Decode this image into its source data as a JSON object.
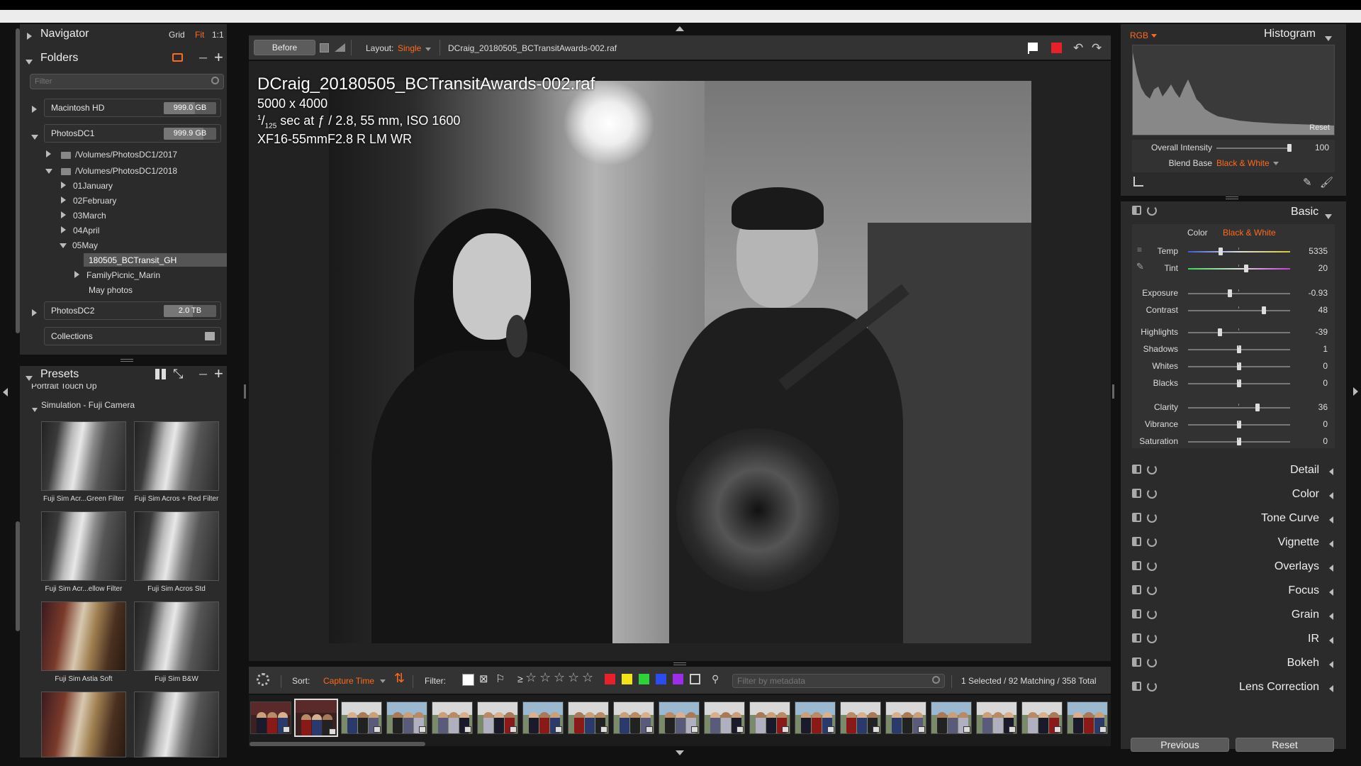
{
  "navigator": {
    "title": "Navigator",
    "grid": "Grid",
    "fit": "Fit",
    "one_to_one": "1:1"
  },
  "folders": {
    "title": "Folders",
    "filter_placeholder": "Filter",
    "volumes": [
      {
        "name": "Macintosh HD",
        "size": "999.0 GB",
        "fill": 0.6
      },
      {
        "name": "PhotosDC1",
        "size": "999.9 GB",
        "fill": 0.75
      },
      {
        "name": "PhotosDC2",
        "size": "2.0 TB",
        "fill": 0.55
      }
    ],
    "tree": {
      "path2017": "/Volumes/PhotosDC1/2017",
      "path2018": "/Volumes/PhotosDC1/2018",
      "months": [
        "01January",
        "02February",
        "03March",
        "04April",
        "05May"
      ],
      "selected": "180505_BCTransit_GH",
      "sub1": "FamilyPicnic_Marin",
      "sub2": "May photos"
    },
    "collections": "Collections"
  },
  "presets": {
    "title": "Presets",
    "prev_group": "Portrait Touch Up",
    "group": "Simulation - Fuji Camera",
    "items": [
      "Fuji Sim Acr...Green Filter",
      "Fuji Sim Acros + Red Filter",
      "Fuji Sim Acr...ellow Filter",
      "Fuji Sim Acros Std",
      "Fuji Sim Astia Soft",
      "Fuji Sim B&W"
    ]
  },
  "toolbar": {
    "before": "Before",
    "layout_label": "Layout:",
    "layout_value": "Single",
    "filename": "DCraig_20180505_BCTransitAwards-002.raf"
  },
  "overlay": {
    "filename": "DCraig_20180505_BCTransitAwards-002.raf",
    "dimensions": "5000 x 4000",
    "shutter_num": "1",
    "shutter_den": "125",
    "exposure_rest": " sec at ƒ / 2.8, 55 mm, ISO 1600",
    "lens": "XF16-55mmF2.8 R LM WR"
  },
  "filterbar": {
    "sort_label": "Sort:",
    "sort_value": "Capture Time",
    "filter_label": "Filter:",
    "ge": "≥",
    "metadata_placeholder": "Filter by metadata",
    "count": "1 Selected / 92 Matching / 358 Total",
    "colors": [
      "#e8202a",
      "#f2e21a",
      "#2ed13a",
      "#2a4cf0",
      "#9b2ee8"
    ]
  },
  "histogram": {
    "mode": "RGB",
    "title": "Histogram",
    "reset": "Reset",
    "overall_label": "Overall Intensity",
    "overall_value": "100",
    "blend_label": "Blend Base",
    "blend_value": "Black & White"
  },
  "basic": {
    "title": "Basic",
    "tab_color": "Color",
    "tab_bw": "Black & White",
    "sliders": [
      {
        "label": "Temp",
        "value": "5335",
        "pos": 0.32
      },
      {
        "label": "Tint",
        "value": "20",
        "pos": 0.57
      },
      {
        "label": "Exposure",
        "value": "-0.93",
        "pos": 0.41
      },
      {
        "label": "Contrast",
        "value": "48",
        "pos": 0.74
      },
      {
        "label": "Highlights",
        "value": "-39",
        "pos": 0.31
      },
      {
        "label": "Shadows",
        "value": "1",
        "pos": 0.5
      },
      {
        "label": "Whites",
        "value": "0",
        "pos": 0.5
      },
      {
        "label": "Blacks",
        "value": "0",
        "pos": 0.5
      },
      {
        "label": "Clarity",
        "value": "36",
        "pos": 0.68
      },
      {
        "label": "Vibrance",
        "value": "0",
        "pos": 0.5
      },
      {
        "label": "Saturation",
        "value": "0",
        "pos": 0.5
      }
    ]
  },
  "sections": [
    "Detail",
    "Color",
    "Tone Curve",
    "Vignette",
    "Overlays",
    "Focus",
    "Grain",
    "IR",
    "Bokeh",
    "Lens Correction"
  ],
  "bottom": {
    "previous": "Previous",
    "reset": "Reset"
  }
}
